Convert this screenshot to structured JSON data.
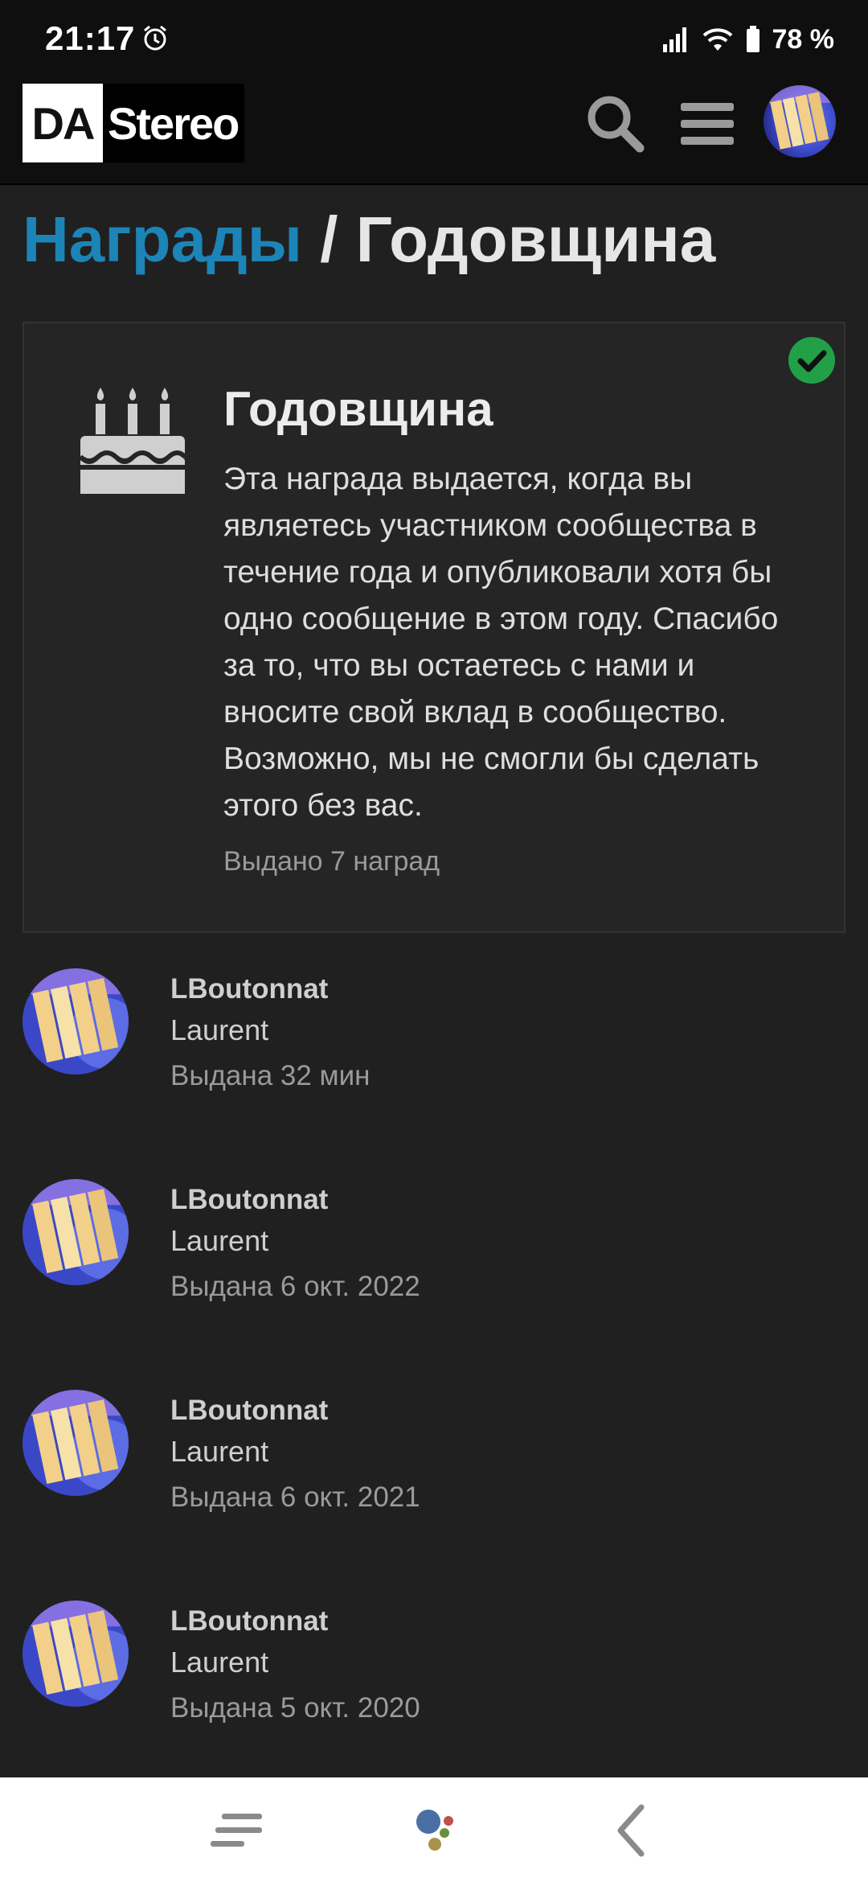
{
  "status_bar": {
    "time": "21:17",
    "battery": "78 %",
    "icons": [
      "alarm-icon",
      "signal-icon",
      "wifi-icon",
      "battery-icon"
    ]
  },
  "header": {
    "logo_da": "DA",
    "logo_stereo": "Stereo",
    "icons": [
      "search-icon",
      "menu-icon",
      "user-avatar"
    ]
  },
  "page": {
    "breadcrumb": "Награды",
    "separator": " / ",
    "current": "Годовщина"
  },
  "trophy": {
    "title": "Годовщина",
    "description": "Эта награда выдается, когда вы являетесь участником сообщества в течение года и опубликовали хотя бы одно сообщение в этом году. Спасибо за то, что вы остаетесь с нами и вносите свой вклад в сообщество. Возможно, мы не смогли бы сделать этого без вас.",
    "awarded_count": "Выдано 7 наград",
    "icon": "cake-icon",
    "earned_icon": "check-circle-icon",
    "accent_color": "#1c84b6",
    "check_color": "#21a048"
  },
  "recipients": [
    {
      "username": "LBoutonnat",
      "name": "Laurent",
      "date": "Выдана 32 мин"
    },
    {
      "username": "LBoutonnat",
      "name": "Laurent",
      "date": "Выдана 6 окт. 2022"
    },
    {
      "username": "LBoutonnat",
      "name": "Laurent",
      "date": "Выдана 6 окт. 2021"
    },
    {
      "username": "LBoutonnat",
      "name": "Laurent",
      "date": "Выдана 5 окт. 2020"
    }
  ],
  "nav": {
    "icons": [
      "recent-apps-icon",
      "assistant-icon",
      "back-icon"
    ]
  }
}
